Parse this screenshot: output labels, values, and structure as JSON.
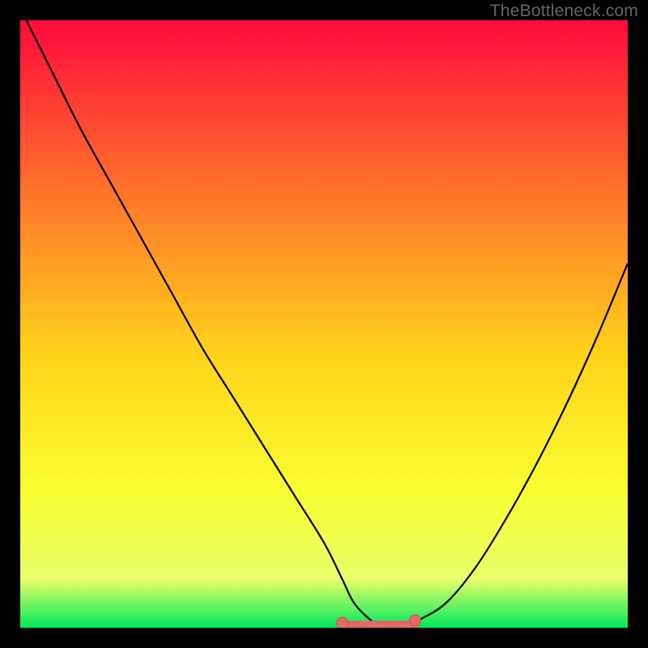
{
  "watermark": "TheBottleneck.com",
  "colors": {
    "gradient_top": "#ff0a3c",
    "gradient_mid_upper": "#ff7a2a",
    "gradient_mid": "#ffd21a",
    "gradient_lower": "#f8ff33",
    "gradient_band": "#eaff6a",
    "gradient_bottom": "#00e85a",
    "curve": "#000000",
    "marker": "#e46a6a",
    "marker_stroke": "#c94f4f"
  },
  "chart_data": {
    "type": "line",
    "title": "",
    "xlabel": "",
    "ylabel": "",
    "xlim": [
      0,
      100
    ],
    "ylim": [
      0,
      100
    ],
    "series": [
      {
        "name": "bottleneck-curve",
        "x": [
          1,
          5,
          10,
          15,
          20,
          25,
          30,
          35,
          40,
          45,
          50,
          53,
          55,
          58,
          60,
          62,
          65,
          70,
          75,
          80,
          85,
          90,
          95,
          100
        ],
        "values": [
          100,
          92,
          82,
          73,
          64,
          55,
          46,
          38,
          30,
          22,
          14,
          8,
          4,
          1,
          0,
          0,
          1,
          4,
          10,
          18,
          27,
          37,
          48,
          60
        ]
      }
    ],
    "flat_region": {
      "x_start": 53,
      "x_end": 65,
      "y": 0.5
    },
    "markers": [
      {
        "x": 53,
        "y": 0.8
      },
      {
        "x": 65,
        "y": 1.2
      }
    ]
  }
}
